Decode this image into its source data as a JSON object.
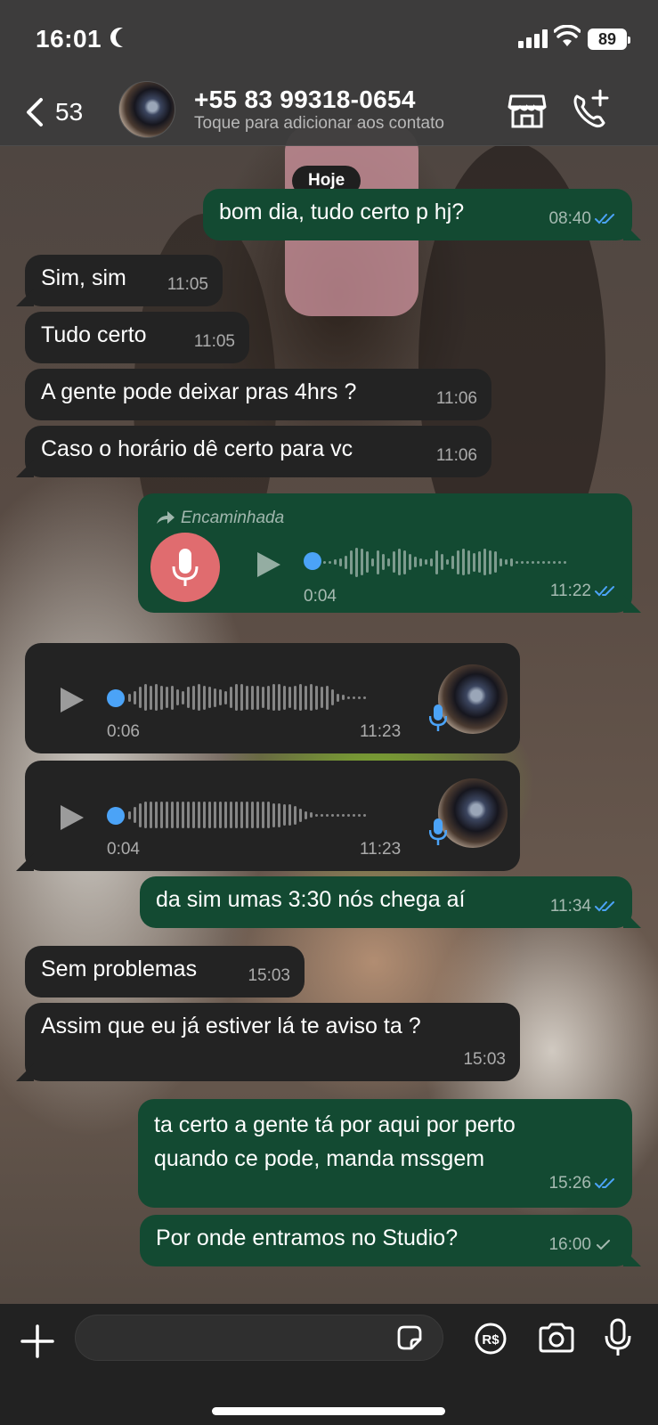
{
  "status_bar": {
    "time": "16:01",
    "battery": "89"
  },
  "header": {
    "back_count": "53",
    "contact_name": "+55 83 99318-0654",
    "contact_subtitle": "Toque para adicionar aos contato"
  },
  "chat": {
    "day_label": "Hoje",
    "messages": [
      {
        "dir": "out",
        "text": "bom dia, tudo certo p hj?",
        "time": "08:40",
        "status": "read"
      },
      {
        "dir": "in",
        "text": "Sim, sim",
        "time": "11:05"
      },
      {
        "dir": "in",
        "text": "Tudo certo",
        "time": "11:05"
      },
      {
        "dir": "in",
        "text": "A gente pode deixar pras 4hrs ?",
        "time": "11:06"
      },
      {
        "dir": "in",
        "text": "Caso o horário dê certo para vc",
        "time": "11:06"
      },
      {
        "dir": "out",
        "type": "voice",
        "forwarded_label": "Encaminhada",
        "duration": "0:04",
        "time": "11:22",
        "status": "read"
      },
      {
        "dir": "in",
        "type": "voice",
        "duration": "0:06",
        "time": "11:23"
      },
      {
        "dir": "in",
        "type": "voice",
        "duration": "0:04",
        "time": "11:23"
      },
      {
        "dir": "out",
        "text": "da sim umas 3:30 nós chega aí",
        "time": "11:34",
        "status": "read"
      },
      {
        "dir": "in",
        "text": "Sem problemas",
        "time": "15:03"
      },
      {
        "dir": "in",
        "text": "Assim que eu já estiver lá te aviso ta ?",
        "time": "15:03"
      },
      {
        "dir": "out",
        "text_line1": "ta certo a gente tá por aqui por perto",
        "text_line2": "quando ce pode, manda mssgem",
        "time": "15:26",
        "status": "read"
      },
      {
        "dir": "out",
        "text": "Por onde entramos no Studio?",
        "time": "16:00",
        "status": "sent"
      }
    ]
  },
  "input_bar": {
    "placeholder": "",
    "value": ""
  },
  "colors": {
    "outgoing": "#134a32",
    "incoming": "#232323",
    "read_tick": "#4ba3f7",
    "voice_dot": "#4ba3f7",
    "record_red": "#e06c6f"
  },
  "icons": [
    "back-chevron-icon",
    "store-icon",
    "add-call-icon",
    "forward-arrow-icon",
    "mic-icon",
    "play-icon",
    "double-check-icon",
    "single-check-icon",
    "plus-icon",
    "sticker-icon",
    "pix-payment-icon",
    "camera-icon"
  ]
}
